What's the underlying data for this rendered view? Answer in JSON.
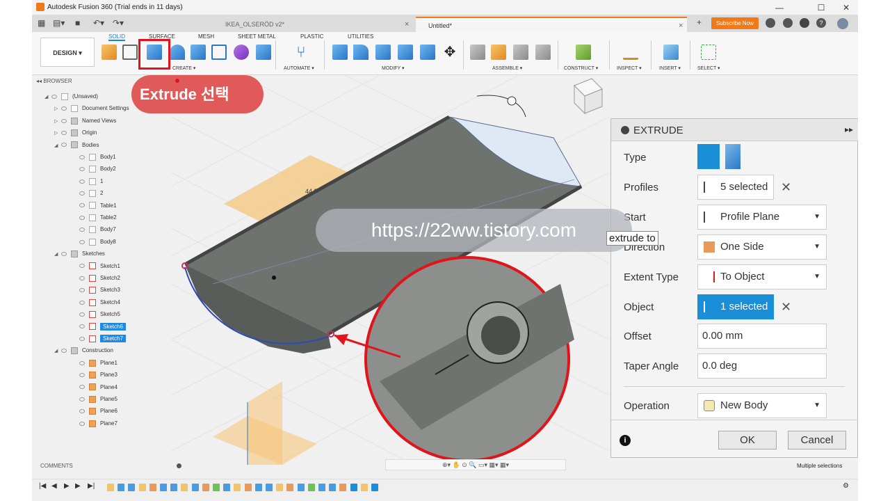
{
  "window": {
    "title": "Autodesk Fusion 360 (Trial ends in 11 days)",
    "min": "—",
    "max": "☐",
    "close": "✕"
  },
  "tabs": [
    {
      "label": "IKEA_OLSERÖD v2*",
      "active": false
    },
    {
      "label": "Untitled*",
      "active": true
    }
  ],
  "header": {
    "subscribe": "Subscribe Now",
    "tab_close": "×",
    "add_tab": "+"
  },
  "toolbar": {
    "design": "DESIGN ▾",
    "workspace_tabs": [
      "SOLID",
      "SURFACE",
      "MESH",
      "SHEET METAL",
      "PLASTIC",
      "UTILITIES"
    ],
    "groups": [
      "CREATE ▾",
      "AUTOMATE ▾",
      "MODIFY ▾",
      "ASSEMBLE ▾",
      "CONSTRUCT ▾",
      "INSPECT ▾",
      "INSERT ▾",
      "SELECT ▾"
    ]
  },
  "browser": {
    "header": "BROWSER",
    "items": [
      {
        "label": "(Unsaved)",
        "indent": 0,
        "type": "doc"
      },
      {
        "label": "Document Settings",
        "indent": 1,
        "type": "gear"
      },
      {
        "label": "Named Views",
        "indent": 1,
        "type": "folder"
      },
      {
        "label": "Origin",
        "indent": 1,
        "type": "folder"
      },
      {
        "label": "Bodies",
        "indent": 1,
        "type": "folder"
      },
      {
        "label": "Body1",
        "indent": 2,
        "type": "body"
      },
      {
        "label": "Body2",
        "indent": 2,
        "type": "body"
      },
      {
        "label": "1",
        "indent": 2,
        "type": "body"
      },
      {
        "label": "2",
        "indent": 2,
        "type": "body"
      },
      {
        "label": "Table1",
        "indent": 2,
        "type": "body"
      },
      {
        "label": "Table2",
        "indent": 2,
        "type": "body"
      },
      {
        "label": "Body7",
        "indent": 2,
        "type": "body"
      },
      {
        "label": "Body8",
        "indent": 2,
        "type": "body"
      },
      {
        "label": "Sketches",
        "indent": 1,
        "type": "folder"
      },
      {
        "label": "Sketch1",
        "indent": 2,
        "type": "sketch"
      },
      {
        "label": "Sketch2",
        "indent": 2,
        "type": "sketch"
      },
      {
        "label": "Sketch3",
        "indent": 2,
        "type": "sketch"
      },
      {
        "label": "Sketch4",
        "indent": 2,
        "type": "sketch"
      },
      {
        "label": "Sketch5",
        "indent": 2,
        "type": "sketch"
      },
      {
        "label": "Sketch6",
        "indent": 2,
        "type": "sketch",
        "selected": true
      },
      {
        "label": "Sketch7",
        "indent": 2,
        "type": "sketch",
        "selected": true
      },
      {
        "label": "Construction",
        "indent": 1,
        "type": "folder"
      },
      {
        "label": "Plane1",
        "indent": 2,
        "type": "plane"
      },
      {
        "label": "Plane3",
        "indent": 2,
        "type": "plane"
      },
      {
        "label": "Plane4",
        "indent": 2,
        "type": "plane"
      },
      {
        "label": "Plane5",
        "indent": 2,
        "type": "plane"
      },
      {
        "label": "Plane6",
        "indent": 2,
        "type": "plane"
      },
      {
        "label": "Plane7",
        "indent": 2,
        "type": "plane"
      }
    ]
  },
  "comments": "COMMENTS",
  "callout": "Extrude 선택",
  "viewport": {
    "dimension": "44.30",
    "watermark": "https://22ww.tistory.com",
    "tooltip": "extrude to"
  },
  "extrude_panel": {
    "title": "EXTRUDE",
    "rows": [
      {
        "label": "Type"
      },
      {
        "label": "Profiles",
        "value": "5 selected",
        "clear": "✕"
      },
      {
        "label": "Start",
        "value": "Profile Plane",
        "dropdown": true
      },
      {
        "label": "Direction",
        "value": "One Side",
        "dropdown": true
      },
      {
        "label": "Extent Type",
        "value": "To Object",
        "dropdown": true
      },
      {
        "label": "Object",
        "value": "1 selected",
        "clear": "✕"
      },
      {
        "label": "Offset",
        "value": "0.00 mm"
      },
      {
        "label": "Taper Angle",
        "value": "0.0 deg"
      },
      {
        "label": "Operation",
        "value": "New Body",
        "dropdown": true
      }
    ],
    "ok": "OK",
    "cancel": "Cancel",
    "info": "i"
  },
  "status": "Multiple selections",
  "colors": {
    "accent": "#1e7fd4",
    "highlight_red": "#e0141a",
    "callout_bg": "#e05a5a",
    "subscribe": "#f07a1a"
  }
}
